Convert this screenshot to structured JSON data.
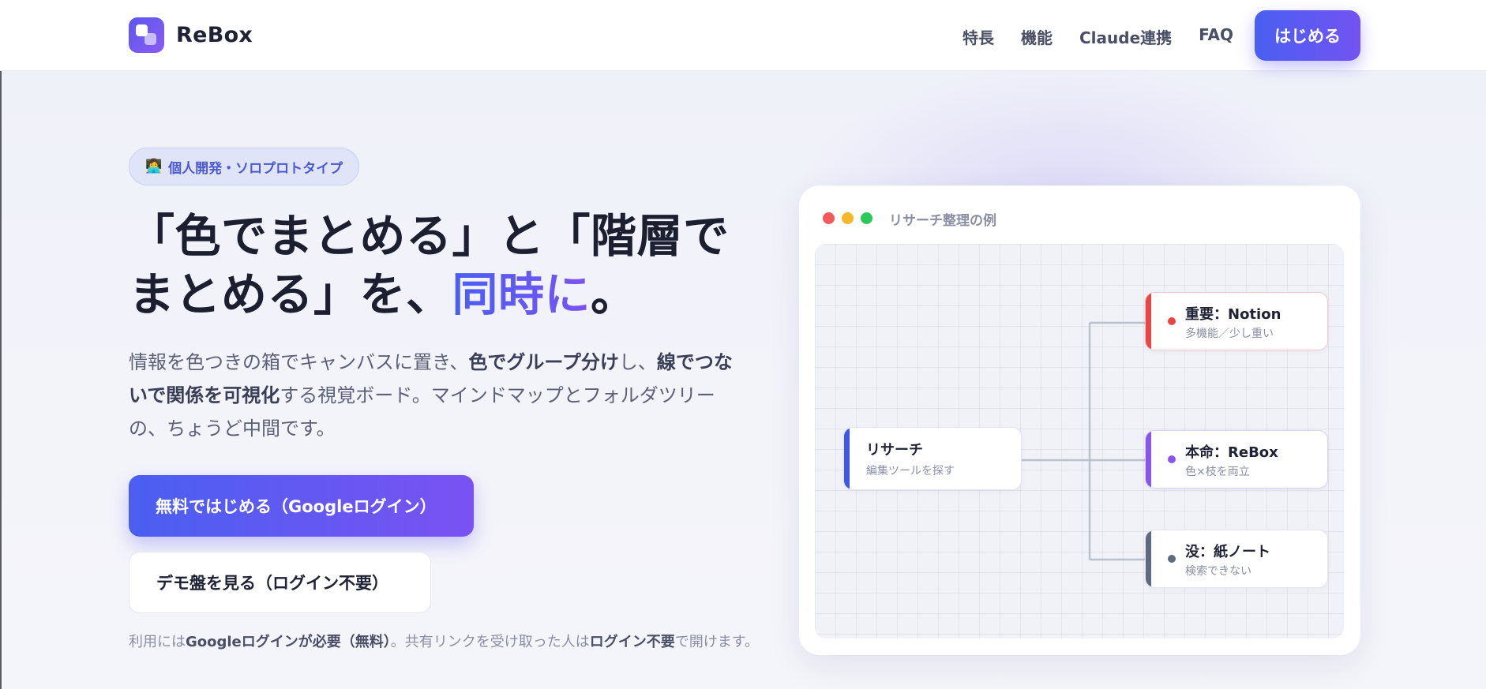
{
  "nav": {
    "logo_text": "ReBox",
    "links": [
      "特長",
      "機能",
      "Claude連携",
      "FAQ"
    ],
    "cta": "はじめる"
  },
  "hero": {
    "badge_icon": "👩‍💻",
    "badge": "個人開発・ソロプロトタイプ",
    "title_line1": "「色でまとめる」と「階層で",
    "title_line2_start": "まとめる」を、",
    "title_accent": "同時に",
    "title_end": "。",
    "desc": {
      "p1": "情報を色つきの箱でキャンバスに置き、",
      "b1": "色でグループ分け",
      "p2": "し、",
      "b2": "線でつないで関係を可視化",
      "p3": "する視覚ボード。マインドマップとフォルダツリーの、ちょうど中間です。"
    },
    "primary_button": "無料ではじめる（Googleログイン）",
    "secondary_button": "デモ盤を見る（ログイン不要）",
    "note": {
      "p1": "利用には",
      "b1": "Googleログインが必要（無料）",
      "p2": "。共有リンクを受け取った人は",
      "b2": "ログイン不要",
      "p3": "で開けます。"
    }
  },
  "demo": {
    "title": "リサーチ整理の例",
    "window_dots": [
      "#f05a5a",
      "#f5b62a",
      "#2ec95b"
    ],
    "root": {
      "title": "リサーチ",
      "sub": "編集ツールを探す",
      "color": "#3f56e6"
    },
    "children": [
      {
        "title": "重要：Notion",
        "sub": "多機能／少し重い",
        "color": "#e84545"
      },
      {
        "title": "本命：ReBox",
        "sub": "色×枝を両立",
        "color": "#8a55ec"
      },
      {
        "title": "没：紙ノート",
        "sub": "検索できない",
        "color": "#5f6a80"
      }
    ]
  },
  "colors": {
    "accent": "#4a5ff1",
    "accent2": "#7a52f2",
    "text": "#1f2235"
  }
}
